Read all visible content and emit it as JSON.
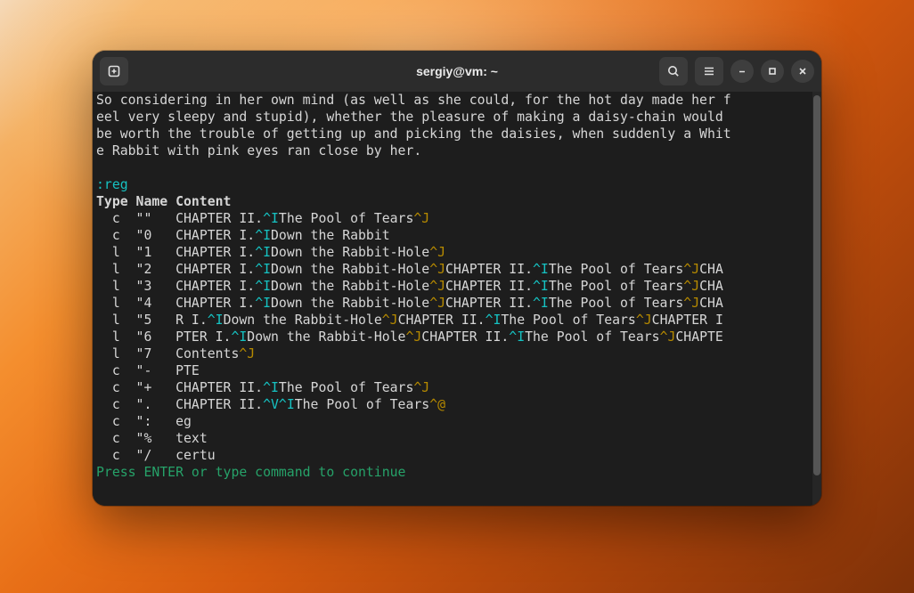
{
  "titlebar": {
    "title": "sergiy@vm: ~"
  },
  "body_text": "So considering in her own mind (as well as she could, for the hot day made her f\neel very sleepy and stupid), whether the pleasure of making a daisy-chain would \nbe worth the trouble of getting up and picking the daisies, when suddenly a Whit\ne Rabbit with pink eyes ran close by her.",
  "command": ":reg",
  "header": "Type Name Content",
  "registers": [
    {
      "type": "c",
      "name": "\"\"",
      "segments": [
        {
          "t": "CHAPTER II."
        },
        {
          "t": "^I",
          "cls": "c-cyan"
        },
        {
          "t": "The Pool of Tears"
        },
        {
          "t": "^J",
          "cls": "c-yellow"
        }
      ]
    },
    {
      "type": "c",
      "name": "\"0",
      "segments": [
        {
          "t": "CHAPTER I."
        },
        {
          "t": "^I",
          "cls": "c-cyan"
        },
        {
          "t": "Down the Rabbit"
        }
      ]
    },
    {
      "type": "l",
      "name": "\"1",
      "segments": [
        {
          "t": "CHAPTER I."
        },
        {
          "t": "^I",
          "cls": "c-cyan"
        },
        {
          "t": "Down the Rabbit-Hole"
        },
        {
          "t": "^J",
          "cls": "c-yellow"
        }
      ]
    },
    {
      "type": "l",
      "name": "\"2",
      "segments": [
        {
          "t": "CHAPTER I."
        },
        {
          "t": "^I",
          "cls": "c-cyan"
        },
        {
          "t": "Down the Rabbit-Hole"
        },
        {
          "t": "^J",
          "cls": "c-yellow"
        },
        {
          "t": "CHAPTER II."
        },
        {
          "t": "^I",
          "cls": "c-cyan"
        },
        {
          "t": "The Pool of Tears"
        },
        {
          "t": "^J",
          "cls": "c-yellow"
        },
        {
          "t": "CHA"
        }
      ]
    },
    {
      "type": "l",
      "name": "\"3",
      "segments": [
        {
          "t": "CHAPTER I."
        },
        {
          "t": "^I",
          "cls": "c-cyan"
        },
        {
          "t": "Down the Rabbit-Hole"
        },
        {
          "t": "^J",
          "cls": "c-yellow"
        },
        {
          "t": "CHAPTER II."
        },
        {
          "t": "^I",
          "cls": "c-cyan"
        },
        {
          "t": "The Pool of Tears"
        },
        {
          "t": "^J",
          "cls": "c-yellow"
        },
        {
          "t": "CHA"
        }
      ]
    },
    {
      "type": "l",
      "name": "\"4",
      "segments": [
        {
          "t": "CHAPTER I."
        },
        {
          "t": "^I",
          "cls": "c-cyan"
        },
        {
          "t": "Down the Rabbit-Hole"
        },
        {
          "t": "^J",
          "cls": "c-yellow"
        },
        {
          "t": "CHAPTER II."
        },
        {
          "t": "^I",
          "cls": "c-cyan"
        },
        {
          "t": "The Pool of Tears"
        },
        {
          "t": "^J",
          "cls": "c-yellow"
        },
        {
          "t": "CHA"
        }
      ]
    },
    {
      "type": "l",
      "name": "\"5",
      "segments": [
        {
          "t": "R I."
        },
        {
          "t": "^I",
          "cls": "c-cyan"
        },
        {
          "t": "Down the Rabbit-Hole"
        },
        {
          "t": "^J",
          "cls": "c-yellow"
        },
        {
          "t": "CHAPTER II."
        },
        {
          "t": "^I",
          "cls": "c-cyan"
        },
        {
          "t": "The Pool of Tears"
        },
        {
          "t": "^J",
          "cls": "c-yellow"
        },
        {
          "t": "CHAPTER I"
        }
      ]
    },
    {
      "type": "l",
      "name": "\"6",
      "segments": [
        {
          "t": "PTER I."
        },
        {
          "t": "^I",
          "cls": "c-cyan"
        },
        {
          "t": "Down the Rabbit-Hole"
        },
        {
          "t": "^J",
          "cls": "c-yellow"
        },
        {
          "t": "CHAPTER II."
        },
        {
          "t": "^I",
          "cls": "c-cyan"
        },
        {
          "t": "The Pool of Tears"
        },
        {
          "t": "^J",
          "cls": "c-yellow"
        },
        {
          "t": "CHAPTE"
        }
      ]
    },
    {
      "type": "l",
      "name": "\"7",
      "segments": [
        {
          "t": "Contents"
        },
        {
          "t": "^J",
          "cls": "c-yellow"
        }
      ]
    },
    {
      "type": "c",
      "name": "\"-",
      "segments": [
        {
          "t": "PTE"
        }
      ]
    },
    {
      "type": "c",
      "name": "\"+",
      "segments": [
        {
          "t": "CHAPTER II."
        },
        {
          "t": "^I",
          "cls": "c-cyan"
        },
        {
          "t": "The Pool of Tears"
        },
        {
          "t": "^J",
          "cls": "c-yellow"
        }
      ]
    },
    {
      "type": "c",
      "name": "\".",
      "segments": [
        {
          "t": "CHAPTER II."
        },
        {
          "t": "^V^I",
          "cls": "c-cyan"
        },
        {
          "t": "The Pool of Tears"
        },
        {
          "t": "^@",
          "cls": "c-yellow"
        }
      ]
    },
    {
      "type": "c",
      "name": "\":",
      "segments": [
        {
          "t": "eg"
        }
      ]
    },
    {
      "type": "c",
      "name": "\"%",
      "segments": [
        {
          "t": "text"
        }
      ]
    },
    {
      "type": "c",
      "name": "\"/",
      "segments": [
        {
          "t": "certu"
        }
      ]
    }
  ],
  "prompt": "Press ENTER or type command to continue"
}
